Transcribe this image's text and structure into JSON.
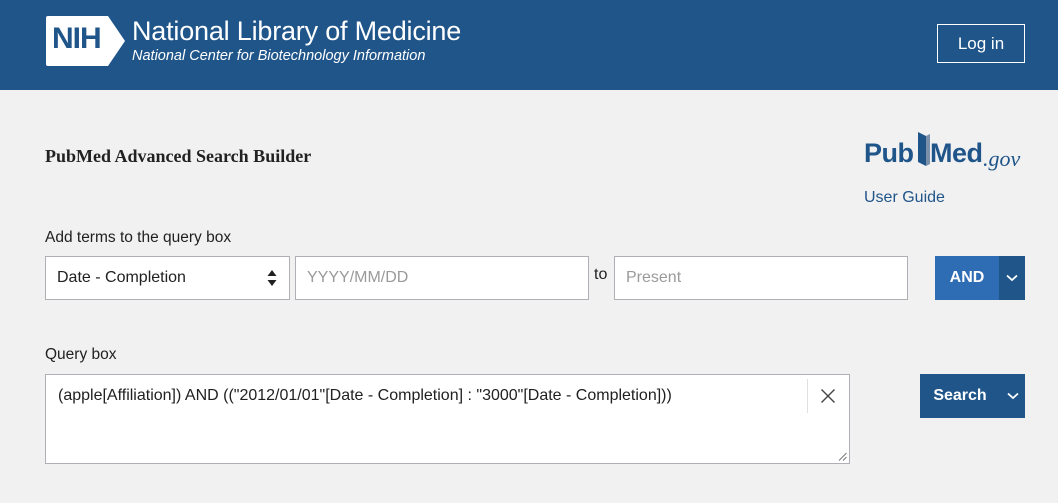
{
  "header": {
    "logo_text": "NIH",
    "title": "National Library of Medicine",
    "subtitle": "National Center for Biotechnology Information",
    "login_label": "Log in",
    "bg_color": "#20558a"
  },
  "page": {
    "title": "PubMed Advanced Search Builder",
    "logo": {
      "part1": "Pub",
      "part2": "Med",
      "suffix": ".gov"
    },
    "user_guide_label": "User Guide"
  },
  "builder": {
    "label": "Add terms to the query box",
    "field_select_value": "Date - Completion",
    "date_from_placeholder": "YYYY/MM/DD",
    "to_label": "to",
    "date_to_placeholder": "Present",
    "operator_label": "AND"
  },
  "query": {
    "label": "Query box",
    "value": "(apple[Affiliation]) AND ((\"2012/01/01\"[Date - Completion] : \"3000\"[Date - Completion]))",
    "search_label": "Search"
  },
  "icons": {
    "clear": "close-icon",
    "dropdown": "chevron-down-icon",
    "select_arrows": "sort-arrows-icon"
  },
  "colors": {
    "primary": "#2e6cb3",
    "dark": "#20558a",
    "background": "#f1f1f1"
  }
}
